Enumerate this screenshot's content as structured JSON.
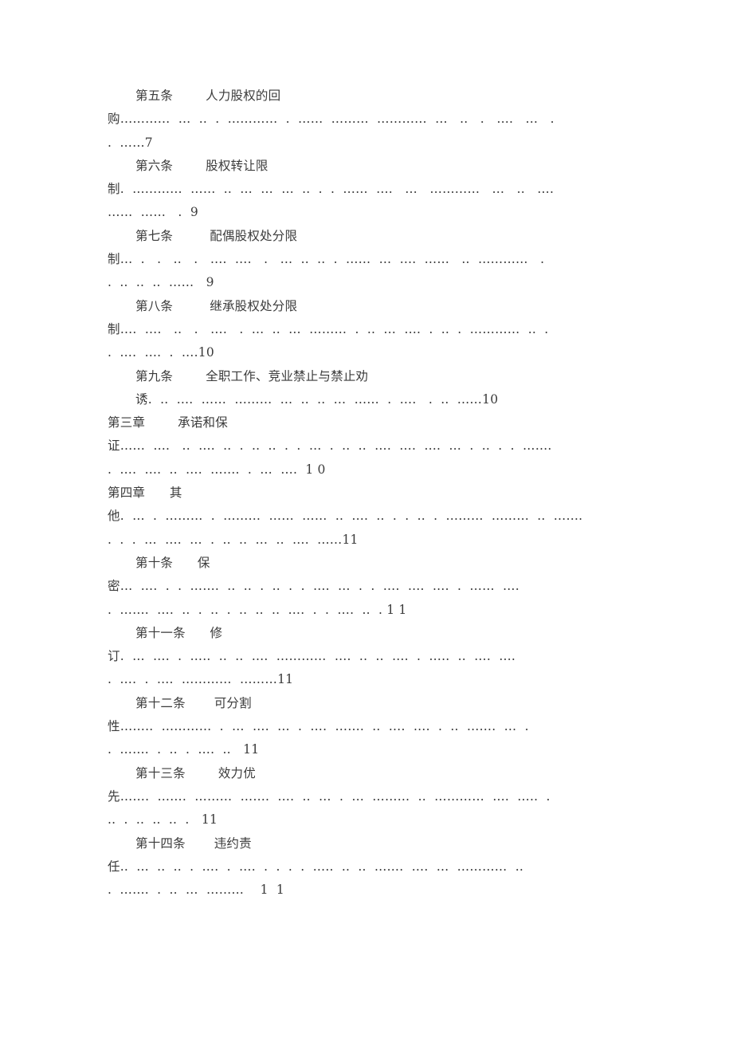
{
  "document": {
    "kind": "table-of-contents",
    "language": "zh-CN",
    "text_color": "#3b3b3b",
    "page_background": "#ffffff"
  },
  "toc": {
    "entries": [
      {
        "level": "article",
        "number": "第五条",
        "title": "人力股权的回",
        "continuation_label": "购",
        "page": "7",
        "lines": [
          {
            "indent": true,
            "text": "第五条        人力股权的回"
          },
          {
            "indent": false,
            "text": "购…………  …  ..  .  …………  .  ……  ………  …………  …   ..   .   ….   …   ."
          },
          {
            "indent": false,
            "text": ".  ……7"
          }
        ]
      },
      {
        "level": "article",
        "number": "第六条",
        "title": "股权转让限",
        "continuation_label": "制",
        "page": "9",
        "lines": [
          {
            "indent": true,
            "text": "第六条        股权转让限"
          },
          {
            "indent": false,
            "text": "制.  …………  ……  ..  …  …  …  ..  .  .  ……  ….   …   …………   …   ..   …."
          },
          {
            "indent": false,
            "text": "……  ……   .  9"
          }
        ]
      },
      {
        "level": "article",
        "number": "第七条",
        "title": "配偶股权处分限",
        "continuation_label": "制",
        "page": "9",
        "lines": [
          {
            "indent": true,
            "text": "第七条         配偶股权处分限"
          },
          {
            "indent": false,
            "text": "制…  .   .   ..   .   ….  ….   .   …  ..  ..  .  ……  …  ….  ……   ..  …………   ."
          },
          {
            "indent": false,
            "text": ".  ..  ..  ..  ……   9"
          }
        ]
      },
      {
        "level": "article",
        "number": "第八条",
        "title": "继承股权处分限",
        "continuation_label": "制",
        "page": "10",
        "lines": [
          {
            "indent": true,
            "text": "第八条         继承股权处分限"
          },
          {
            "indent": false,
            "text": "制….  ….   ..   .   ….   .  …  ..  …  ………  .  ..  …  ….  .  ..  .  …………  ..  ."
          },
          {
            "indent": false,
            "text": ".  ….  ….  .  ….10"
          }
        ]
      },
      {
        "level": "article",
        "number": "第九条",
        "title": "全职工作、竞业禁止与禁止劝",
        "continuation_label": "诱",
        "page": "10",
        "lines": [
          {
            "indent": true,
            "text": "第九条        全职工作、竞业禁止与禁止劝"
          },
          {
            "indent": true,
            "text": "诱.  ..  ….  ……  ………  …  ..  ..  …  ……  .  ….   .  ..  ……10"
          }
        ]
      },
      {
        "level": "chapter",
        "number": "第三章",
        "title": "承诺和保",
        "continuation_label": "证",
        "page": "1 0",
        "lines": [
          {
            "indent": false,
            "text": "第三章        承诺和保"
          },
          {
            "indent": false,
            "text": "证……  ….   ..  ….  ..  .  ..  ..  .  .  …  .  ..  ..  ….  ….  ….  …  .  ..  .  .  ……."
          },
          {
            "indent": false,
            "text": ".  ….  ….  ..  ….  …….  .  …  ….  1 0"
          }
        ]
      },
      {
        "level": "chapter",
        "number": "第四章",
        "title": "其",
        "continuation_label": "他",
        "page": "11",
        "lines": [
          {
            "indent": false,
            "text": "第四章      其"
          },
          {
            "indent": false,
            "text": "他.  …  .  ………  .  ………  ……  ……  ..  ….  ..  .  .  ..  .  ………  ………  ..  ……."
          },
          {
            "indent": false,
            "text": ".  .  .  …  ….  …  .  ..  ..  …  ..  ….  ……11"
          }
        ]
      },
      {
        "level": "article",
        "number": "第十条",
        "title": "保",
        "continuation_label": "密",
        "page": "1 1",
        "lines": [
          {
            "indent": true,
            "text": "第十条      保"
          },
          {
            "indent": false,
            "text": "密…  ….  .  .  …….  ..  ..  .  ..  .  .  ….  …  .  .  ….  ….  ….  .  ……  …."
          },
          {
            "indent": false,
            "text": ".  …….  ….  ..  .  ..  .  ..  ..  ..  ….  .  .  ….  ..  . 1 1"
          }
        ]
      },
      {
        "level": "article",
        "number": "第十一条",
        "title": "修",
        "continuation_label": "订",
        "page": "11",
        "lines": [
          {
            "indent": true,
            "text": "第十一条      修"
          },
          {
            "indent": false,
            "text": "订.  …  ….  .  …..  ..  ..  ….  …………  ….  ..  ..  ….  .  …..  ..  ….  …."
          },
          {
            "indent": false,
            "text": ".  ….  .  ….  …………  ………11"
          }
        ]
      },
      {
        "level": "article",
        "number": "第十二条",
        "title": "可分割",
        "continuation_label": "性",
        "page": "11",
        "lines": [
          {
            "indent": true,
            "text": "第十二条       可分割"
          },
          {
            "indent": false,
            "text": "性……..  …………  .  …  ….  …  .  ….  …….  ..  ….  ….  .  ..  …….  …  ."
          },
          {
            "indent": false,
            "text": ".  …….  .  ..  .  ….  ..   11"
          }
        ]
      },
      {
        "level": "article",
        "number": "第十三条",
        "title": "效力优",
        "continuation_label": "先",
        "page": "11",
        "lines": [
          {
            "indent": true,
            "text": "第十三条        效力优"
          },
          {
            "indent": false,
            "text": "先…….  …….  ………  …….  ….  ..  …  .  …  ………  ..  …………  ….  …..  ."
          },
          {
            "indent": false,
            "text": "..  .  ..  ..  ..  .   11"
          }
        ]
      },
      {
        "level": "article",
        "number": "第十四条",
        "title": "违约责",
        "continuation_label": "任",
        "page": "1  1",
        "lines": [
          {
            "indent": true,
            "text": "第十四条       违约责"
          },
          {
            "indent": false,
            "text": "任..  …  ..  ..  .  ….  .  ….  .  .  .  .  …..  ..  ..  …….  ….  …  …………  .."
          },
          {
            "indent": false,
            "text": ".  …….  .  ..  …  ………    1  1"
          }
        ]
      }
    ]
  }
}
